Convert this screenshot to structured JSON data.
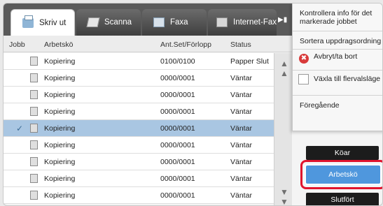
{
  "tabs": [
    {
      "label": "Skriv ut",
      "icon": "printer-icon",
      "active": true
    },
    {
      "label": "Scanna",
      "icon": "scanner-icon",
      "active": false
    },
    {
      "label": "Faxa",
      "icon": "fax-icon",
      "active": false
    },
    {
      "label": "Internet-Fax",
      "icon": "internet-fax-icon",
      "active": false
    }
  ],
  "table": {
    "headers": {
      "job": "Jobb",
      "queue": "Arbetskö",
      "progress": "Ant.Set/Förlopp",
      "status": "Status"
    },
    "rows": [
      {
        "name": "Kopiering",
        "progress": "0100/0100",
        "status": "Papper Slut"
      },
      {
        "name": "Kopiering",
        "progress": "0000/0001",
        "status": "Väntar"
      },
      {
        "name": "Kopiering",
        "progress": "0000/0001",
        "status": "Väntar"
      },
      {
        "name": "Kopiering",
        "progress": "0000/0001",
        "status": "Väntar"
      },
      {
        "name": "Kopiering",
        "progress": "0000/0001",
        "status": "Väntar",
        "selected": true
      },
      {
        "name": "Kopiering",
        "progress": "0000/0001",
        "status": "Väntar"
      },
      {
        "name": "Kopiering",
        "progress": "0000/0001",
        "status": "Väntar"
      },
      {
        "name": "Kopiering",
        "progress": "0000/0001",
        "status": "Väntar"
      },
      {
        "name": "Kopiering",
        "progress": "0000/0001",
        "status": "Väntar"
      }
    ]
  },
  "menu": {
    "items": [
      "Kontrollera info för det markerade jobbet",
      "Sortera uppdragsordning",
      "Avbryt/ta bort",
      "Växla till flervalsläge",
      "Föregående"
    ]
  },
  "side_buttons": {
    "queue": "Köar",
    "jobs": "Arbetskö",
    "completed": "Slutfört"
  },
  "colors": {
    "selected_row": "#a9c6e2",
    "active_button": "#4f97dd",
    "highlight": "#e0142e"
  }
}
